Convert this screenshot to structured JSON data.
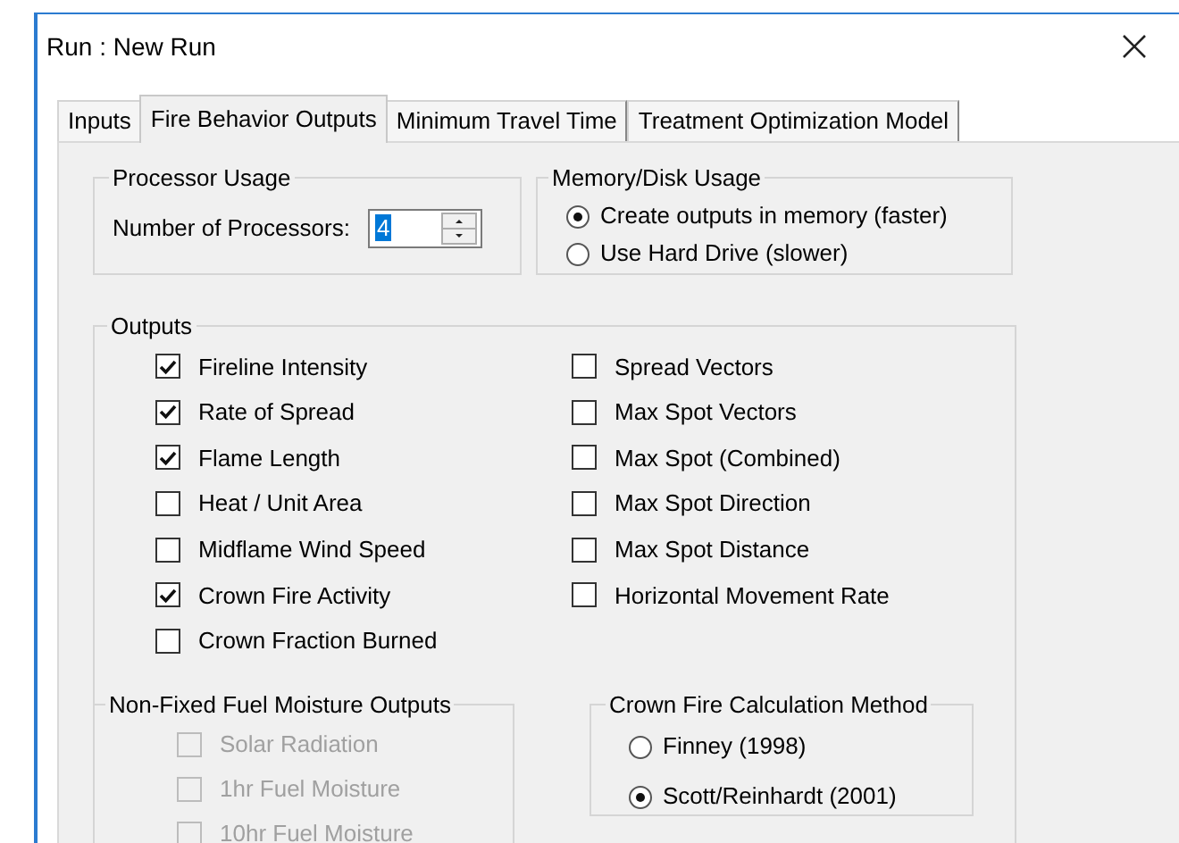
{
  "window": {
    "title": "Run : New Run"
  },
  "tabs": [
    {
      "label": "Inputs",
      "selected": false
    },
    {
      "label": "Fire Behavior Outputs",
      "selected": true
    },
    {
      "label": "Minimum Travel Time",
      "selected": false
    },
    {
      "label": "Treatment Optimization Model",
      "selected": false
    }
  ],
  "processor_usage": {
    "title": "Processor Usage",
    "label": "Number of Processors:",
    "value": "4"
  },
  "memory_disk_usage": {
    "title": "Memory/Disk Usage",
    "options": [
      {
        "label": "Create outputs in memory (faster)",
        "selected": true
      },
      {
        "label": "Use Hard Drive (slower)",
        "selected": false
      }
    ]
  },
  "outputs": {
    "title": "Outputs",
    "columns": [
      [
        {
          "label": "Fireline Intensity",
          "checked": true
        },
        {
          "label": "Rate of Spread",
          "checked": true
        },
        {
          "label": "Flame Length",
          "checked": true
        },
        {
          "label": "Heat / Unit Area",
          "checked": false
        },
        {
          "label": "Midflame Wind Speed",
          "checked": false
        },
        {
          "label": "Crown Fire Activity",
          "checked": true
        },
        {
          "label": "Crown Fraction Burned",
          "checked": false
        }
      ],
      [
        {
          "label": "Spread Vectors",
          "checked": false
        },
        {
          "label": "Max Spot Vectors",
          "checked": false
        },
        {
          "label": "Max Spot (Combined)",
          "checked": false
        },
        {
          "label": "Max Spot Direction",
          "checked": false
        },
        {
          "label": "Max Spot Distance",
          "checked": false
        },
        {
          "label": "Horizontal Movement Rate",
          "checked": false
        }
      ]
    ]
  },
  "fuel_moisture_outputs": {
    "title": "Non-Fixed Fuel Moisture Outputs",
    "items": [
      {
        "label": "Solar Radiation",
        "checked": false,
        "disabled": true
      },
      {
        "label": "1hr Fuel Moisture",
        "checked": false,
        "disabled": true
      },
      {
        "label": "10hr Fuel Moisture",
        "checked": false,
        "disabled": true
      }
    ]
  },
  "crown_fire_method": {
    "title": "Crown Fire Calculation Method",
    "options": [
      {
        "label": "Finney (1998)",
        "selected": false
      },
      {
        "label": "Scott/Reinhardt (2001)",
        "selected": true
      }
    ]
  }
}
